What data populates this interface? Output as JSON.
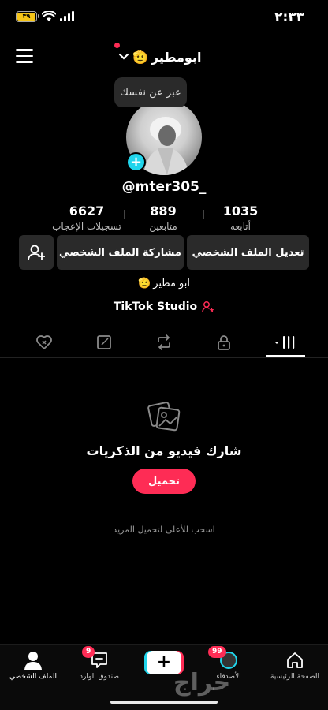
{
  "status_bar": {
    "time": "٢:٣٣",
    "battery": "٣٩"
  },
  "header": {
    "username": "ابومطير"
  },
  "bubble_text": "عبر عن نفسك",
  "handle": "@mter305_",
  "stats": [
    {
      "value": "6627",
      "label": "تسجيلات الإعجاب"
    },
    {
      "value": "889",
      "label": "متابعين"
    },
    {
      "value": "1035",
      "label": "أتابعه"
    }
  ],
  "buttons": {
    "edit_profile": "تعديل الملف الشخصي",
    "share_profile": "مشاركة الملف الشخصي"
  },
  "bio": "ابو مطير",
  "studio_label": "TikTok Studio",
  "empty_state": {
    "title": "شارك فيديو من الذكريات",
    "upload": "تحميل",
    "hint": "اسحب للأعلى لتحميل المزيد"
  },
  "bottom_nav": {
    "home": "الصفحة الرئيسية",
    "friends": "الأصدقاء",
    "friends_badge": "99",
    "inbox": "صندوق الوارد",
    "inbox_badge": "9",
    "profile": "الملف الشخصي"
  },
  "watermark": "حراج",
  "colors": {
    "accent": "#fe2c55",
    "cyan": "#20d5ec",
    "battery": "#f5c518"
  }
}
